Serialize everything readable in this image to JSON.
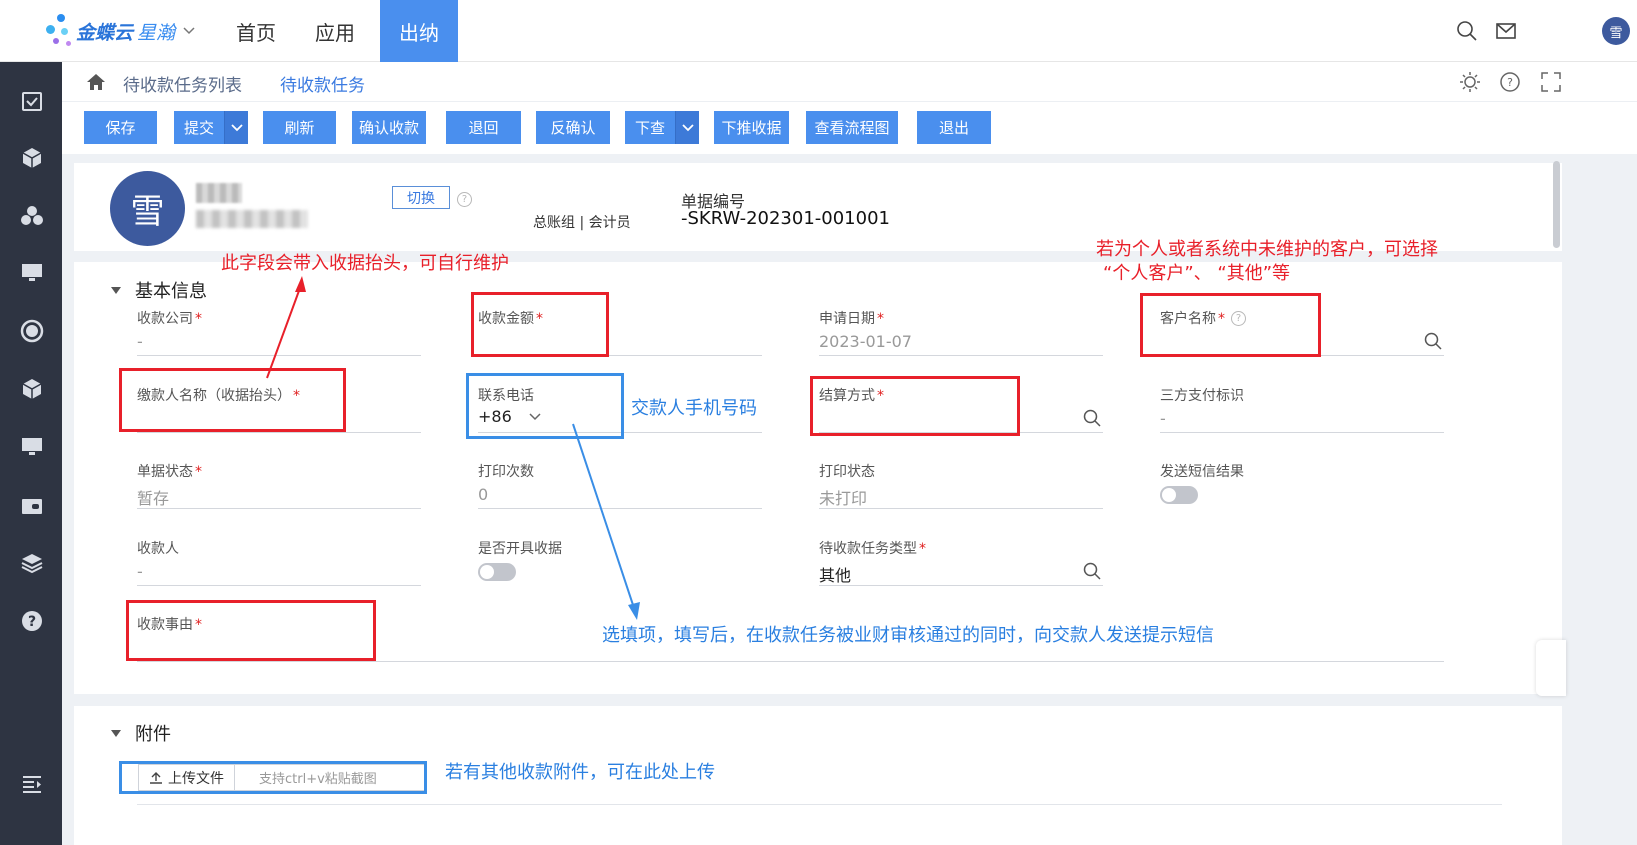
{
  "header": {
    "logo_brand": "金蝶云",
    "logo_product": "星瀚",
    "nav": [
      {
        "label": "首页"
      },
      {
        "label": "应用"
      },
      {
        "label": "出纳"
      }
    ],
    "avatar": "雪"
  },
  "breadcrumb": {
    "items": [
      {
        "label": "待收款任务列表"
      },
      {
        "label": "待收款任务"
      }
    ]
  },
  "toolbar": {
    "save": "保存",
    "submit": "提交",
    "refresh": "刷新",
    "confirm": "确认收款",
    "return": "退回",
    "unconfirm": "反确认",
    "lookup": "下查",
    "push": "下推收据",
    "flow": "查看流程图",
    "exit": "退出"
  },
  "user": {
    "avatar": "雪",
    "switch_label": "切换",
    "org": "总账组 | 会计员",
    "doc_label": "单据编号",
    "doc_no": "-SKRW-202301-001001"
  },
  "basic": {
    "title": "基本信息",
    "fields": {
      "company": {
        "label": "收款公司",
        "value": "-"
      },
      "amount": {
        "label": "收款金额",
        "value": ""
      },
      "apply_date": {
        "label": "申请日期",
        "value": "2023-01-07"
      },
      "customer": {
        "label": "客户名称",
        "value": ""
      },
      "payer": {
        "label": "缴款人名称（收据抬头）",
        "value": ""
      },
      "phone": {
        "label": "联系电话",
        "value": "+86"
      },
      "settle": {
        "label": "结算方式",
        "value": ""
      },
      "third_pay": {
        "label": "三方支付标识",
        "value": "-"
      },
      "status": {
        "label": "单据状态",
        "value": "暂存"
      },
      "print_count": {
        "label": "打印次数",
        "value": "0"
      },
      "print_status": {
        "label": "打印状态",
        "value": "未打印"
      },
      "sms_result": {
        "label": "发送短信结果",
        "value": ""
      },
      "payee": {
        "label": "收款人",
        "value": "-"
      },
      "receipt": {
        "label": "是否开具收据",
        "value": ""
      },
      "task_type": {
        "label": "待收款任务类型",
        "value": "其他"
      },
      "reason": {
        "label": "收款事由",
        "value": ""
      }
    }
  },
  "attachment": {
    "title": "附件",
    "upload": "上传文件",
    "paste_hint": "支持ctrl+v粘贴截图"
  },
  "annotations": {
    "payer_note": "此字段会带入收据抬头，可自行维护",
    "customer_note_1": "若为个人或者系统中未维护的客户，可选择",
    "customer_note_2": "“个人客户”、 “其他”等",
    "phone_note": "交款人手机号码",
    "sms_note": "选填项，填写后，在收款任务被业财审核通过的同时，向交款人发送提示短信",
    "attach_note": "若有其他收款附件，可在此处上传"
  },
  "colors": {
    "primary": "#4a8fee",
    "sidebar": "#2e3442",
    "annotation_red": "#e8202a",
    "annotation_blue": "#2a7fe0"
  }
}
